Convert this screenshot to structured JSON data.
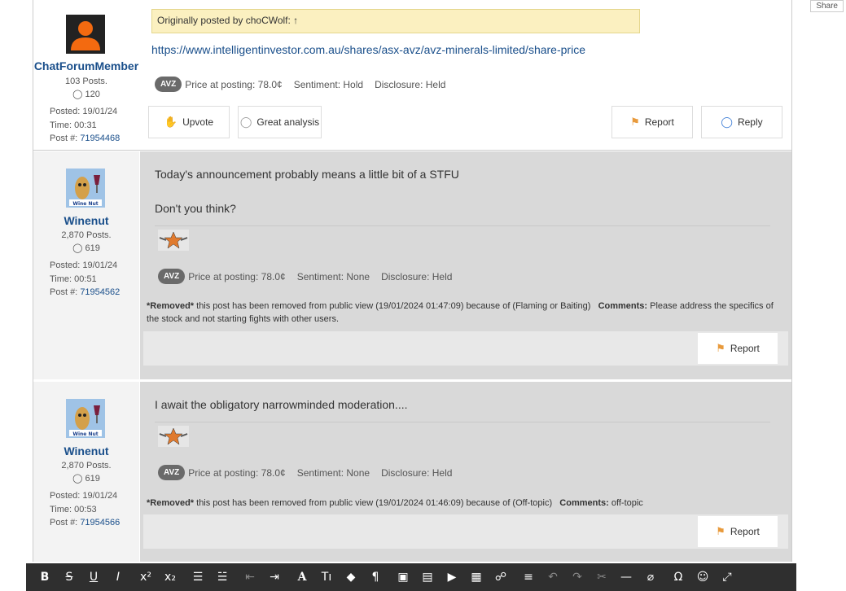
{
  "share_label": "Share",
  "posts": [
    {
      "username": "ChatForumMember",
      "posts_count": "103 Posts.",
      "likes": "120",
      "posted": "Posted: 19/01/24",
      "time": "Time: 00:31",
      "post_label": "Post #:",
      "post_no": "71954468",
      "quote": "Originally posted by choCWolf: ↑",
      "link": "https://www.intelligentinvestor.com.au/shares/asx-avz/avz-minerals-limited/share-price",
      "tag": "AVZ",
      "price": "Price at posting: 78.0¢",
      "sentiment": "Sentiment: Hold",
      "disclosure": "Disclosure: Held",
      "upvote": "Upvote",
      "great": "Great analysis",
      "report": "Report",
      "reply": "Reply"
    },
    {
      "username": "Winenut",
      "posts_count": "2,870 Posts.",
      "likes": "619",
      "posted": "Posted: 19/01/24",
      "time": "Time: 00:51",
      "post_label": "Post #:",
      "post_no": "71954562",
      "line1": "Today's announcement probably means a little bit of a STFU",
      "line2": "Don't you think?",
      "tag": "AVZ",
      "price": "Price at posting: 78.0¢",
      "sentiment": "Sentiment: None",
      "disclosure": "Disclosure: Held",
      "removed_prefix": "*Removed*",
      "removed_text": " this post has been removed from public view (19/01/2024 01:47:09) because of (Flaming or Baiting)",
      "comments_label": "Comments:",
      "comments_text": " Please address the specifics of the stock and not starting fights with other users.",
      "report": "Report"
    },
    {
      "username": "Winenut",
      "posts_count": "2,870 Posts.",
      "likes": "619",
      "posted": "Posted: 19/01/24",
      "time": "Time: 00:53",
      "post_label": "Post #:",
      "post_no": "71954566",
      "line1": "I await the obligatory narrowminded moderation....",
      "tag": "AVZ",
      "price": "Price at posting: 78.0¢",
      "sentiment": "Sentiment: None",
      "disclosure": "Disclosure: Held",
      "removed_prefix": "*Removed*",
      "removed_text": " this post has been removed from public view (19/01/2024 01:46:09) because of (Off-topic)",
      "comments_label": "Comments:",
      "comments_text": " off-topic",
      "report": "Report"
    }
  ],
  "toolbar": {
    "bold": "B",
    "strike": "S",
    "underline": "U",
    "italic": "I",
    "superscript": "x²",
    "subscript": "x₂",
    "bullets": "☰",
    "numbered": "☱",
    "outdent": "⇤",
    "indent": "⇥",
    "font": "A",
    "size": "Tı",
    "color": "◆",
    "paragraph": "¶",
    "image": "▣",
    "file": "▤",
    "video": "▶",
    "table": "▦",
    "link": "☍",
    "align": "≡",
    "undo": "↶",
    "redo": "↷",
    "cut": "✂",
    "hr": "—",
    "clear": "⌀",
    "special": "Ω",
    "emoji": "☺",
    "fullscreen": "⤢"
  }
}
